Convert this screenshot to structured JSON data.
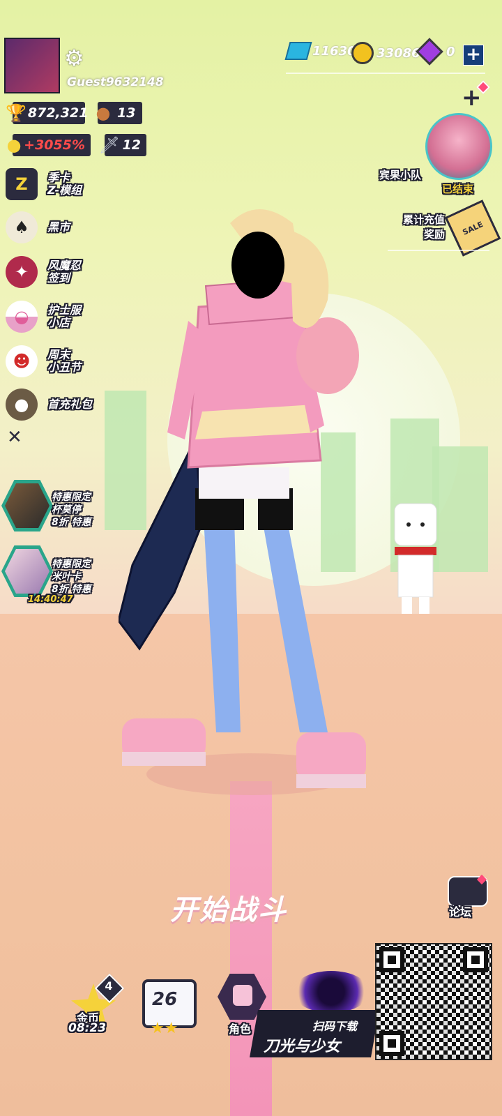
{
  "profile": {
    "username": "Guest9632148",
    "trophies": "872,321",
    "bear_count": "13",
    "bonus": "+3055%",
    "sword_count": "12"
  },
  "currency": {
    "gems": "11630",
    "coins": "33086",
    "crystals": "0"
  },
  "left_menu": [
    {
      "label": "季卡\nZ-模组",
      "icon": "z-badge-icon"
    },
    {
      "label": "黑市",
      "icon": "spade-icon"
    },
    {
      "label": "风魔忍\n签到",
      "icon": "shuriken-icon"
    },
    {
      "label": "护士服\n小店",
      "icon": "capsule-icon"
    },
    {
      "label": "周末\n小丑节",
      "icon": "clown-icon"
    },
    {
      "label": "首充礼包",
      "icon": "piggy-icon"
    }
  ],
  "close_glyph": "✕",
  "promos": [
    {
      "title": "特惠限定",
      "name": "杯莫停",
      "discount": "8折 特惠"
    },
    {
      "title": "特惠限定",
      "name": "米叶卡",
      "discount": "8折 特惠",
      "timer": "14:40:47"
    }
  ],
  "right_panel": {
    "team_label": "宾果小队",
    "team_status": "已结束",
    "recharge_label": "累计充值\n奖励",
    "sale_tag": "SALE",
    "forum_label": "论坛"
  },
  "start_battle": "开始战斗",
  "bottom": {
    "gold_label": "金币",
    "gold_timer": "08:23",
    "gold_badge": "4",
    "level_value": "26",
    "role_label": "角色"
  },
  "download_banner": {
    "scan_label": "扫码下载",
    "game_title": "刀光与少女"
  },
  "colors": {
    "bonus_red": "#ff4b4b",
    "status_yellow": "#f5d23a",
    "accent_blue": "#163e7a"
  }
}
